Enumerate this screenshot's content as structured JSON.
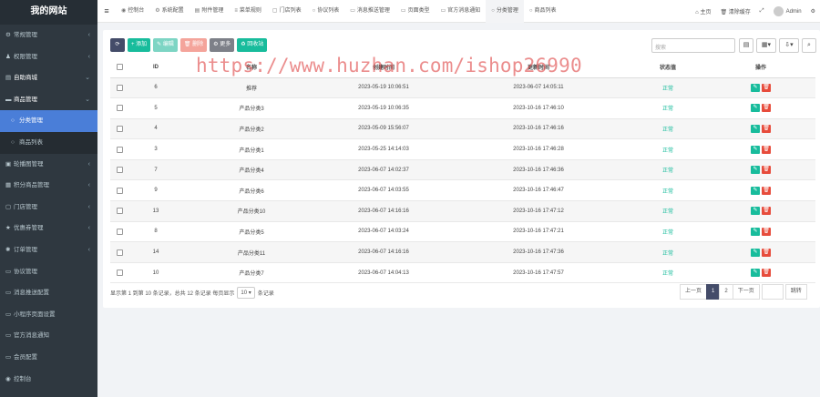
{
  "brand": "我的网站",
  "sidebar": {
    "items": [
      {
        "label": "常规管理",
        "icon": "cogs-icon",
        "glyph": "⚙",
        "arrow": "‹",
        "state": "normal"
      },
      {
        "label": "权限管理",
        "icon": "group-icon",
        "glyph": "♟",
        "arrow": "‹",
        "state": "normal"
      },
      {
        "label": "自助商城",
        "icon": "cart-icon",
        "glyph": "▤",
        "arrow": "⌄",
        "state": "open"
      },
      {
        "label": "商品管理",
        "icon": "folder-icon",
        "glyph": "▬",
        "arrow": "⌄",
        "state": "open"
      },
      {
        "label": "分类管理",
        "icon": "circle-icon",
        "glyph": "○",
        "arrow": "",
        "state": "active"
      },
      {
        "label": "商品列表",
        "icon": "circle-icon",
        "glyph": "○",
        "arrow": "",
        "state": "sub"
      },
      {
        "label": "轮播图管理",
        "icon": "image-icon",
        "glyph": "▣",
        "arrow": "‹",
        "state": "normal"
      },
      {
        "label": "积分商品管理",
        "icon": "gift-icon",
        "glyph": "▦",
        "arrow": "‹",
        "state": "normal"
      },
      {
        "label": "门店管理",
        "icon": "shop-icon",
        "glyph": "▢",
        "arrow": "‹",
        "state": "normal"
      },
      {
        "label": "优惠券管理",
        "icon": "star-icon",
        "glyph": "★",
        "arrow": "‹",
        "state": "normal"
      },
      {
        "label": "订单管理",
        "icon": "gear-icon",
        "glyph": "✺",
        "arrow": "‹",
        "state": "normal"
      },
      {
        "label": "协议管理",
        "icon": "file-icon",
        "glyph": "▭",
        "arrow": "",
        "state": "normal"
      },
      {
        "label": "消息推送配置",
        "icon": "doc-icon",
        "glyph": "▭",
        "arrow": "",
        "state": "normal"
      },
      {
        "label": "小程序页面设置",
        "icon": "doc-icon",
        "glyph": "▭",
        "arrow": "",
        "state": "normal"
      },
      {
        "label": "官方消息通知",
        "icon": "doc-icon",
        "glyph": "▭",
        "arrow": "",
        "state": "normal"
      },
      {
        "label": "会员配置",
        "icon": "doc-icon",
        "glyph": "▭",
        "arrow": "",
        "state": "normal"
      },
      {
        "label": "控制台",
        "icon": "dashboard-icon",
        "glyph": "◉",
        "arrow": "",
        "state": "normal"
      }
    ]
  },
  "topbar": {
    "menu_glyph": "≡",
    "tabs": [
      {
        "label": "控制台",
        "glyph": "◉",
        "active": false
      },
      {
        "label": "系统配置",
        "glyph": "⚙",
        "active": false
      },
      {
        "label": "附件管理",
        "glyph": "▤",
        "active": false
      },
      {
        "label": "菜单规则",
        "glyph": "≡",
        "active": false
      },
      {
        "label": "门店列表",
        "glyph": "▢",
        "active": false
      },
      {
        "label": "协议列表",
        "glyph": "○",
        "active": false
      },
      {
        "label": "消息推送管理",
        "glyph": "▭",
        "active": false
      },
      {
        "label": "页面类型",
        "glyph": "▭",
        "active": false
      },
      {
        "label": "官方消息通知",
        "glyph": "▭",
        "active": false
      },
      {
        "label": "分类管理",
        "glyph": "○",
        "active": true
      },
      {
        "label": "商品列表",
        "glyph": "○",
        "active": false
      }
    ],
    "home": "主页",
    "clear_cache": "清除缓存",
    "user": "Admin"
  },
  "toolbar": {
    "refresh": "⟳",
    "add": "+ 添加",
    "edit": "✎ 编辑",
    "delete": "🗑 删除",
    "more": "⚙ 更多",
    "recycle": "♻ 回收站",
    "search_placeholder": "搜索"
  },
  "table": {
    "headers": [
      "ID",
      "名称",
      "创建时间",
      "更新时间",
      "状态值",
      "操作"
    ],
    "rows": [
      {
        "id": "6",
        "name": "推荐",
        "created": "2023-05-19 10:06:51",
        "updated": "2023-06-07 14:05:11",
        "status": "正常"
      },
      {
        "id": "5",
        "name": "产品分类3",
        "created": "2023-05-19 10:06:35",
        "updated": "2023-10-16 17:46:10",
        "status": "正常"
      },
      {
        "id": "4",
        "name": "产品分类2",
        "created": "2023-05-09 15:56:07",
        "updated": "2023-10-16 17:46:16",
        "status": "正常"
      },
      {
        "id": "3",
        "name": "产品分类1",
        "created": "2023-05-25 14:14:03",
        "updated": "2023-10-16 17:46:28",
        "status": "正常"
      },
      {
        "id": "7",
        "name": "产品分类4",
        "created": "2023-06-07 14:02:37",
        "updated": "2023-10-16 17:46:36",
        "status": "正常"
      },
      {
        "id": "9",
        "name": "产品分类6",
        "created": "2023-06-07 14:03:55",
        "updated": "2023-10-16 17:46:47",
        "status": "正常"
      },
      {
        "id": "13",
        "name": "产品分类10",
        "created": "2023-06-07 14:16:16",
        "updated": "2023-10-16 17:47:12",
        "status": "正常"
      },
      {
        "id": "8",
        "name": "产品分类5",
        "created": "2023-06-07 14:03:24",
        "updated": "2023-10-16 17:47:21",
        "status": "正常"
      },
      {
        "id": "14",
        "name": "产品分类11",
        "created": "2023-06-07 14:16:16",
        "updated": "2023-10-16 17:47:36",
        "status": "正常"
      },
      {
        "id": "10",
        "name": "产品分类7",
        "created": "2023-06-07 14:04:13",
        "updated": "2023-10-16 17:47:57",
        "status": "正常"
      }
    ]
  },
  "footer": {
    "info_prefix": "显示第 1 到第 10 条记录，总共 12 条记录 每页显示",
    "page_size": "10",
    "info_suffix": "条记录"
  },
  "pagination": {
    "prev": "上一页",
    "pages": [
      "1",
      "2"
    ],
    "next": "下一页",
    "jump": "跳转"
  },
  "watermark": "https://www.huzhan.com/ishop26990",
  "colors": {
    "sidebar": "#2f3840",
    "active": "#4a7ed8",
    "success": "#18bc9c",
    "danger": "#e74c3c"
  }
}
